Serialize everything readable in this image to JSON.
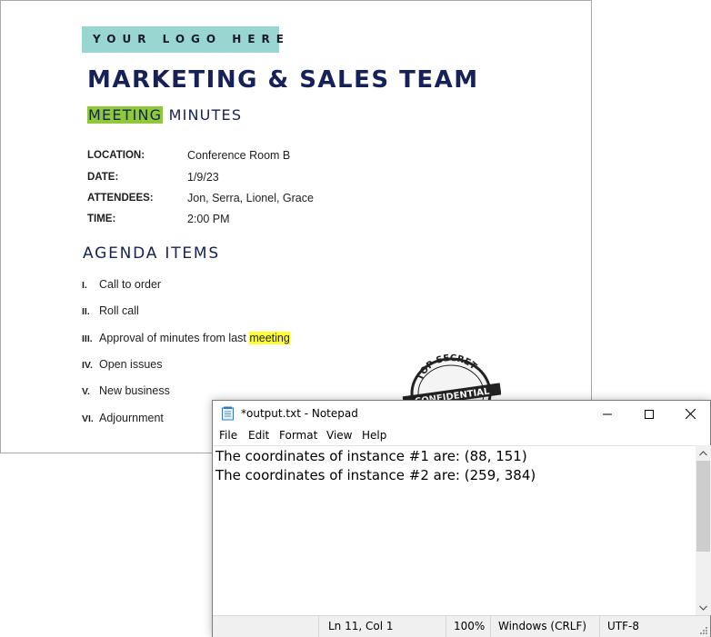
{
  "document": {
    "logo_text": "YOUR LOGO HERE",
    "title": "MARKETING & SALES TEAM",
    "subtitle_highlight": "MEETING",
    "subtitle_rest": " MINUTES",
    "info": [
      {
        "label": "LOCATION:",
        "value": "Conference Room B"
      },
      {
        "label": "DATE:",
        "value": "1/9/23"
      },
      {
        "label": "ATTENDEES:",
        "value": "Jon, Serra, Lionel, Grace"
      },
      {
        "label": "TIME:",
        "value": "2:00 PM"
      }
    ],
    "agenda_heading": "AGENDA ITEMS",
    "agenda": [
      {
        "num": "I.",
        "text": "Call to order"
      },
      {
        "num": "II.",
        "text": "Roll call"
      },
      {
        "num": "III.",
        "text": "Approval of minutes from last ",
        "highlight": "meeting"
      },
      {
        "num": "IV.",
        "text": "Open issues"
      },
      {
        "num": "V.",
        "text": "New business"
      },
      {
        "num": "VI.",
        "text": "Adjournment"
      }
    ],
    "stamp": {
      "top": "TOP SECRET",
      "band": "CONFIDENTIAL"
    }
  },
  "notepad": {
    "title": "*output.txt - Notepad",
    "menu": [
      "File",
      "Edit",
      "Format",
      "View",
      "Help"
    ],
    "lines": [
      "The coordinates of instance #1 are: (88, 151)",
      "The coordinates of instance #2 are: (259, 384)"
    ],
    "status": {
      "position": "Ln 11, Col 1",
      "zoom": "100%",
      "line_ending": "Windows (CRLF)",
      "encoding": "UTF-8"
    }
  },
  "colors": {
    "heading_navy": "#152157",
    "logo_teal": "#99d6d1",
    "highlight_green": "#8fc93a",
    "highlight_yellow": "#ffff33"
  }
}
